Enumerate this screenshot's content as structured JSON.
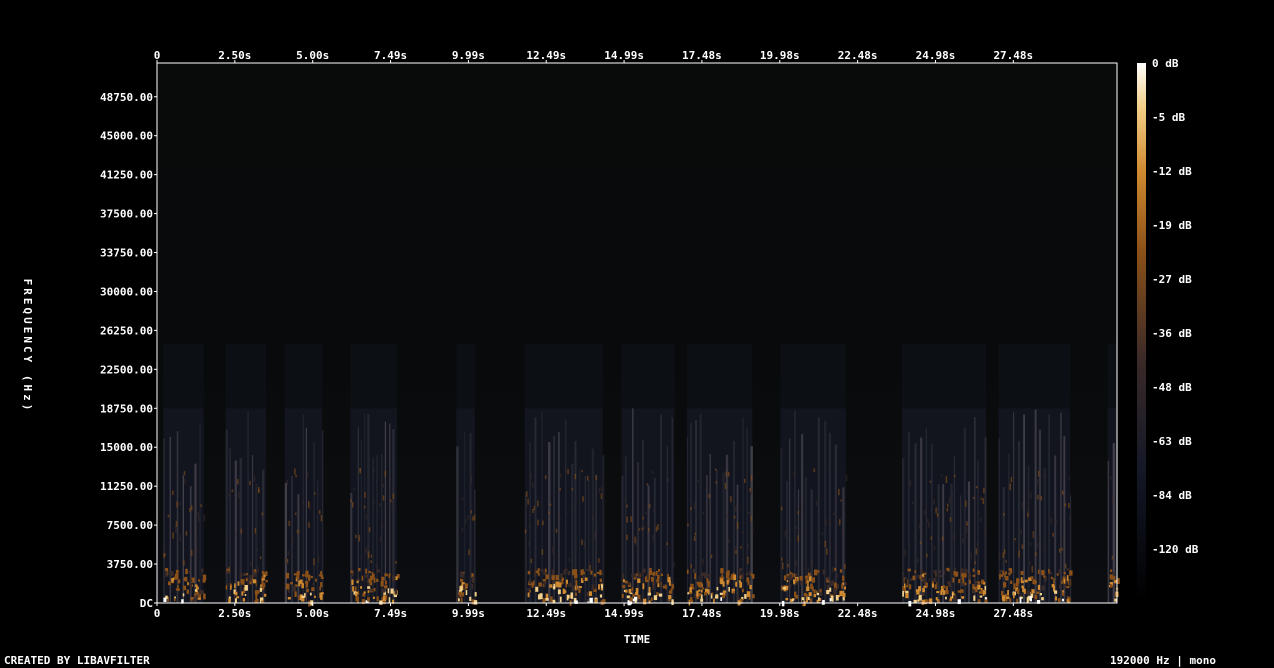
{
  "chart_data": {
    "type": "heatmap",
    "title": "",
    "xlabel": "TIME",
    "ylabel": "FREQUENCY (Hz)",
    "x_ticks": [
      "0",
      "2.50s",
      "5.00s",
      "7.49s",
      "9.99s",
      "12.49s",
      "14.99s",
      "17.48s",
      "19.98s",
      "22.48s",
      "24.98s",
      "27.48s"
    ],
    "y_ticks": [
      "DC",
      "3750.00",
      "7500.00",
      "11250.00",
      "15000.00",
      "18750.00",
      "22500.00",
      "26250.00",
      "30000.00",
      "33750.00",
      "37500.00",
      "41250.00",
      "45000.00",
      "48750.00"
    ],
    "xlim_seconds": [
      0,
      30.8
    ],
    "ylim_hz": [
      0,
      52000
    ],
    "colorbar_ticks": [
      "0 dB",
      "-5 dB",
      "-12 dB",
      "-19 dB",
      "-27 dB",
      "-36 dB",
      "-48 dB",
      "-63 dB",
      "-84 dB",
      "-120 dB"
    ],
    "activity_segments_seconds": [
      [
        0.2,
        1.5
      ],
      [
        2.2,
        3.5
      ],
      [
        4.1,
        5.3
      ],
      [
        6.2,
        7.7
      ],
      [
        9.6,
        10.2
      ],
      [
        11.8,
        14.3
      ],
      [
        14.9,
        16.6
      ],
      [
        17.0,
        19.1
      ],
      [
        20.0,
        22.1
      ],
      [
        23.9,
        26.6
      ],
      [
        27.0,
        29.3
      ],
      [
        30.5,
        30.8
      ]
    ],
    "max_frequency_content_hz": 18750,
    "colormap": [
      "#000000",
      "#141827",
      "#3a2a28",
      "#8a5018",
      "#d08a30",
      "#f3d08a",
      "#ffffff"
    ]
  },
  "footer": {
    "left": "CREATED BY LIBAVFILTER",
    "right": "192000 Hz | mono"
  }
}
